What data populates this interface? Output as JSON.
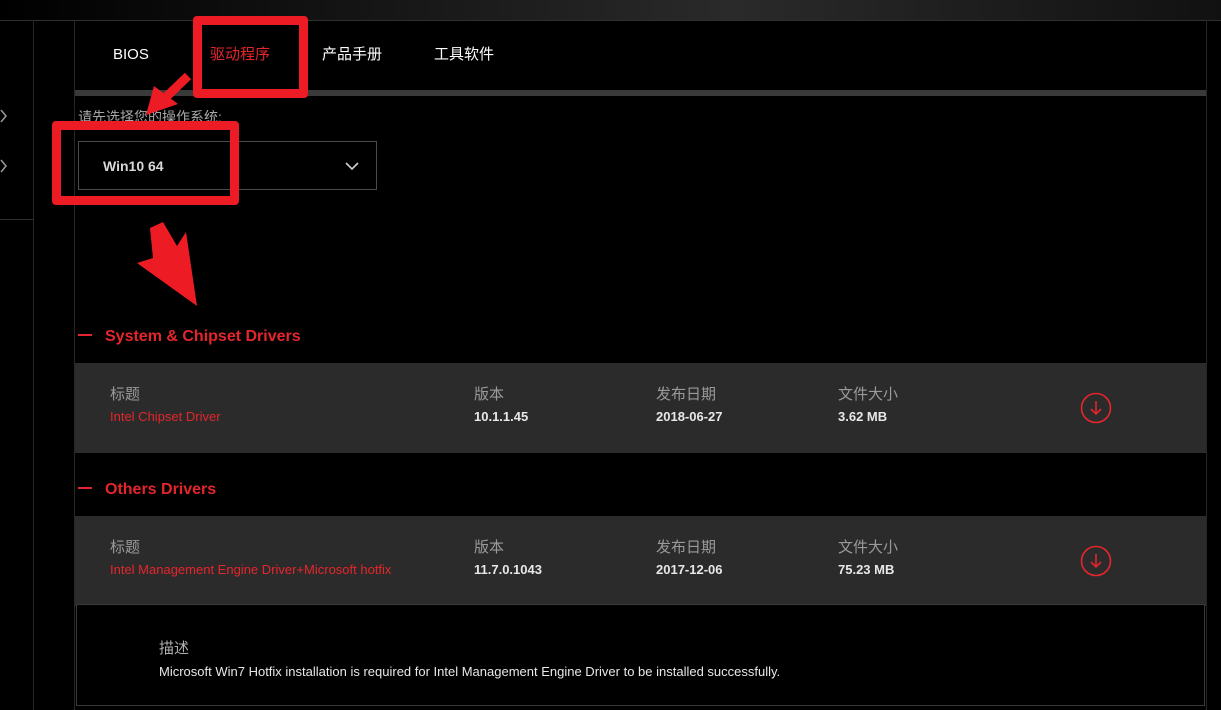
{
  "tabs": [
    {
      "label": "BIOS"
    },
    {
      "label": "驱动程序"
    },
    {
      "label": "产品手册"
    },
    {
      "label": "工具软件"
    }
  ],
  "os_label": "请先选择您的操作系统:",
  "os_selected": "Win10 64",
  "sections": [
    {
      "title": "System & Chipset Drivers",
      "rows": [
        {
          "headers": {
            "title": "标题",
            "version": "版本",
            "date": "发布日期",
            "size": "文件大小"
          },
          "title": "Intel Chipset Driver",
          "version": "10.1.1.45",
          "date": "2018-06-27",
          "size": "3.62 MB"
        }
      ]
    },
    {
      "title": "Others Drivers",
      "rows": [
        {
          "headers": {
            "title": "标题",
            "version": "版本",
            "date": "发布日期",
            "size": "文件大小"
          },
          "title": "Intel Management Engine Driver+Microsoft hotfix",
          "version": "11.7.0.1043",
          "date": "2017-12-06",
          "size": "75.23 MB",
          "description_label": "描述",
          "description": "Microsoft Win7 Hotfix installation is required for Intel Management Engine Driver to be installed successfully."
        }
      ]
    }
  ],
  "colors": {
    "accent": "#e4262c",
    "annotation": "#ed1c24",
    "row_bg": "#2b2b2b"
  },
  "icons": [
    "chevron-right-icon",
    "chevron-down-icon",
    "download-icon",
    "annotation-arrow-icon"
  ]
}
